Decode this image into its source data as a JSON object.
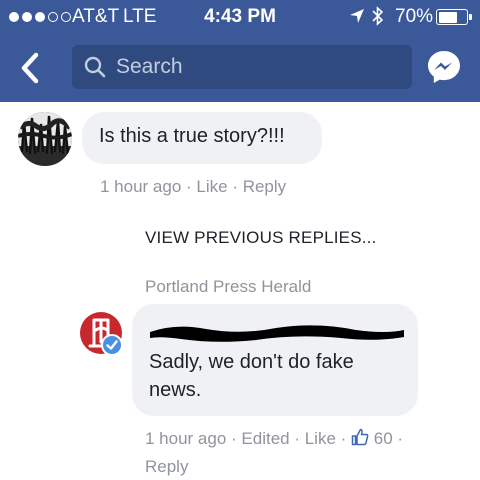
{
  "status_bar": {
    "carrier": "AT&T",
    "network": "LTE",
    "time": "4:43 PM",
    "battery": "70%",
    "battery_level": 0.7
  },
  "nav": {
    "search_placeholder": "Search"
  },
  "comment": {
    "text": "Is this a true story?!!!",
    "time": "1 hour ago",
    "like": "Like",
    "reply": "Reply"
  },
  "view_previous": "VIEW PREVIOUS REPLIES...",
  "reply": {
    "author": "Portland Press Herald",
    "text": "Sadly, we don't do fake news.",
    "time": "1 hour ago",
    "edited": "Edited",
    "like": "Like",
    "like_count": "60",
    "reply": "Reply"
  },
  "separator": " · ",
  "colors": {
    "header": "#3b5998",
    "bubble": "#f0f1f4",
    "meta_text": "#90949c",
    "avatar_brand": "#c8272d",
    "verified": "#4a90e2"
  }
}
